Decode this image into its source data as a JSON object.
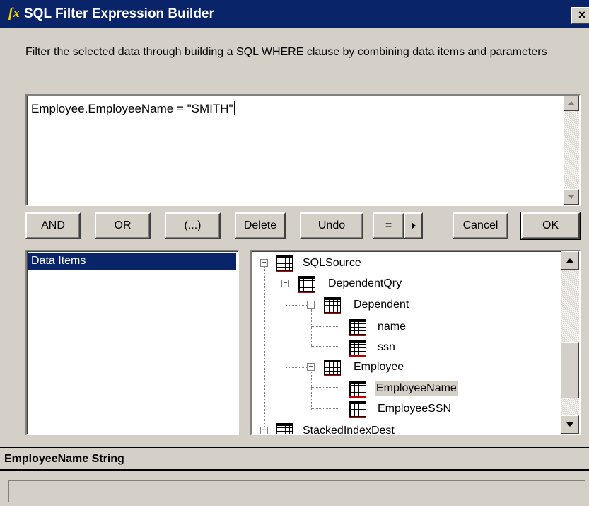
{
  "window": {
    "title": "SQL Filter Expression Builder",
    "title_icon": "fx",
    "close_glyph": "×"
  },
  "description": "Filter the selected data through building a SQL WHERE clause by combining data items and parameters",
  "expression": {
    "value": "Employee.EmployeeName = \"SMITH\""
  },
  "buttons": {
    "and": "AND",
    "or": "OR",
    "paren": "(...)",
    "delete": "Delete",
    "undo": "Undo",
    "equals": "=",
    "cancel": "Cancel",
    "ok": "OK"
  },
  "left_list": {
    "items": [
      "Data Items"
    ],
    "selected": "Data Items"
  },
  "tree": {
    "nodes": [
      {
        "label": "SQLSource",
        "expander": "−"
      },
      {
        "label": "DependentQry",
        "expander": "−"
      },
      {
        "label": "Dependent",
        "expander": "−"
      },
      {
        "label": "name"
      },
      {
        "label": "ssn"
      },
      {
        "label": "Employee",
        "expander": "−"
      },
      {
        "label": "EmployeeName",
        "selected": true
      },
      {
        "label": "EmployeeSSN"
      },
      {
        "label": "StackedIndexDest",
        "expander": "+"
      }
    ]
  },
  "status": {
    "line1": "EmployeeName String",
    "line2": ""
  },
  "colors": {
    "titlebar": "#0a246a",
    "face": "#d4d0c8",
    "selection": "#0a246a"
  }
}
